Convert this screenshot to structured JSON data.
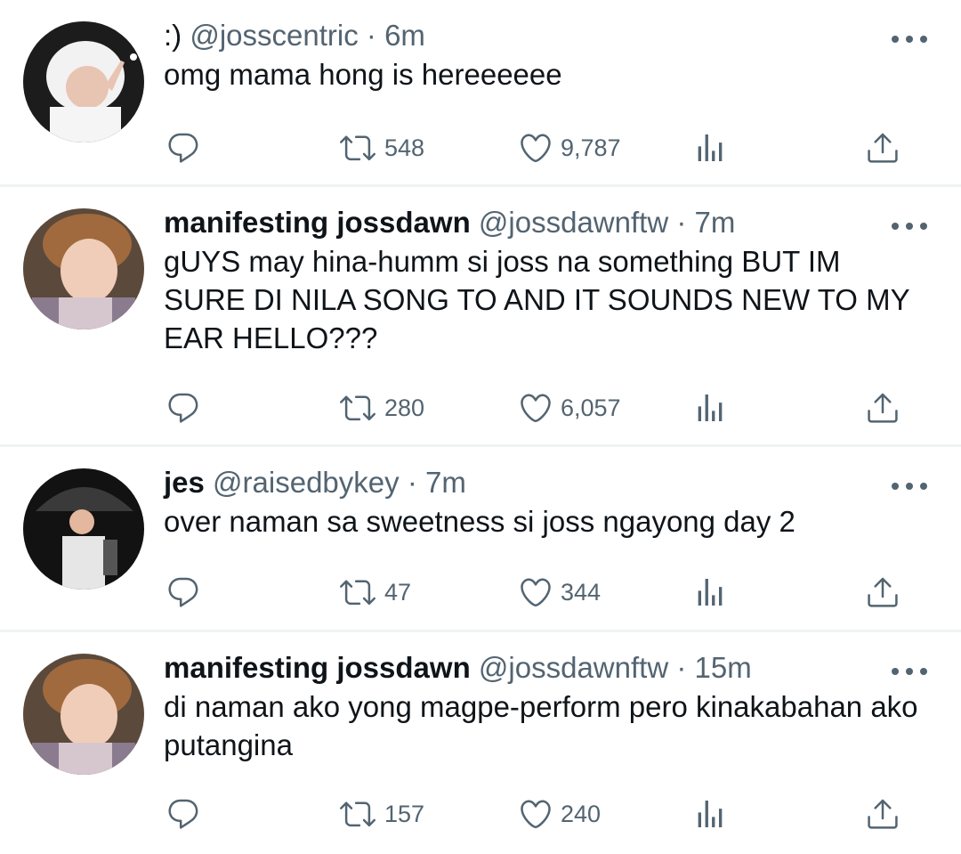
{
  "tweets": [
    {
      "display_name": ":)",
      "handle": "@josscentric",
      "time": "6m",
      "text": "omg mama hong is hereeeeee",
      "retweets": "548",
      "likes": "9,787"
    },
    {
      "display_name": "manifesting jossdawn",
      "handle": "@jossdawnftw",
      "time": "7m",
      "text": "gUYS may hina-humm si joss na something BUT IM SURE DI NILA SONG TO AND IT SOUNDS NEW TO MY EAR HELLO???",
      "retweets": "280",
      "likes": "6,057"
    },
    {
      "display_name": "jes",
      "handle": "@raisedbykey",
      "time": "7m",
      "text": "over naman sa sweetness si joss ngayong day 2",
      "retweets": "47",
      "likes": "344"
    },
    {
      "display_name": "manifesting jossdawn",
      "handle": "@jossdawnftw",
      "time": "15m",
      "text": "di naman ako yong magpe-perform pero kinakabahan ako putangina",
      "retweets": "157",
      "likes": "240"
    }
  ],
  "icons": {
    "reply": "reply-icon",
    "retweet": "retweet-icon",
    "like": "heart-icon",
    "views": "analytics-icon",
    "share": "share-icon",
    "more": "more-icon"
  },
  "colors": {
    "text": "#0f1419",
    "secondary": "#536471",
    "divider": "#eff3f4"
  }
}
